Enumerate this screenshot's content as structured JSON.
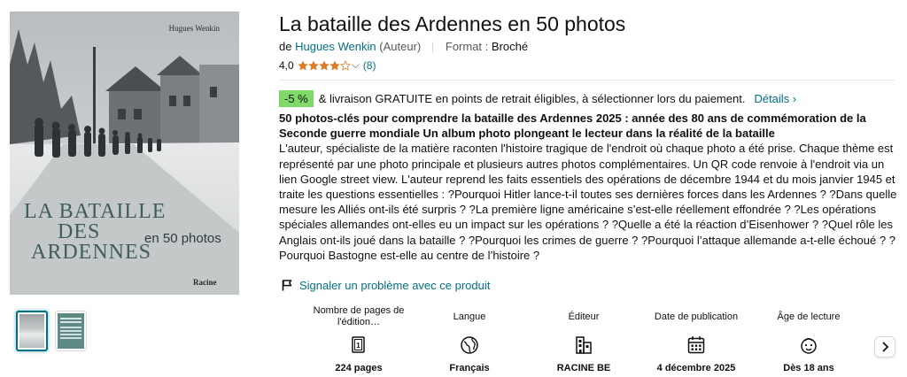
{
  "cover": {
    "author": "Hugues Wenkin",
    "title_line1": "La bataille",
    "title_line2": "des",
    "title_line3": "Ardennes",
    "subtitle": "en 50 photos",
    "publisher": "Racine"
  },
  "thumbnails": [
    "thumb-cover",
    "thumb-back"
  ],
  "product": {
    "title": "La bataille des Ardennes en 50 photos",
    "by_prefix": "de",
    "author": "Hugues Wenkin",
    "author_role": "(Auteur)",
    "separator": "|",
    "format_label": "Format :",
    "format_value": "Broché",
    "rating_value": "4,0",
    "rating_stars": 4,
    "rating_count": "(8)"
  },
  "deal": {
    "discount": "-5 %",
    "text": "& livraison GRATUITE en points de retrait éligibles, à sélectionner lors du paiement.",
    "details_link": "Détails ›"
  },
  "description": {
    "headline": "50 photos-clés pour comprendre la bataille des Ardennes 2025 : année des 80 ans de commémoration de la Seconde guerre mondiale Un album photo plongeant le lecteur dans la réalité de la bataille",
    "body": "L'auteur, spécialiste de la matière raconten l'histoire tragique de l'endroit où chaque photo a été prise. Chaque thème est représenté par une photo principale et plusieurs autres photos complémentaires. Un QR code renvoie à l'endroit via un lien Google street view. L'auteur reprend les faits essentiels des opérations de décembre 1944 et du mois janvier 1945 et traite les questions essentielles : ?Pourquoi Hitler lance-t-il toutes ses dernières forces dans les Ardennes ? ?Dans quelle mesure les Alliés ont-ils été surpris ? ?La première ligne américaine s’est-elle réellement effondrée ? ?Les opérations spéciales allemandes ont-elles eu un impact sur les opérations ? ?Quelle a été la réaction d’Eisenhower ? ?Quel rôle les Anglais ont-ils joué dans la bataille ? ?Pourquoi les crimes de guerre ? ?Pourquoi l’attaque allemande a-t-elle échoué ? ?Pourquoi Bastogne est-elle au centre de l’histoire ?"
  },
  "report_link": "Signaler un problème avec ce produit",
  "attributes": [
    {
      "label": "Nombre de pages de l'édition…",
      "icon": "pages-icon",
      "value": "224 pages"
    },
    {
      "label": "Langue",
      "icon": "globe-icon",
      "value": "Français"
    },
    {
      "label": "Éditeur",
      "icon": "building-icon",
      "value": "RACINE BE"
    },
    {
      "label": "Date de publication",
      "icon": "calendar-icon",
      "value": "4 décembre 2025"
    },
    {
      "label": "Âge de lecture",
      "icon": "child-face-icon",
      "value": "Dès 18 ans"
    }
  ],
  "colors": {
    "link": "#007185",
    "star": "#de7921",
    "badge": "#7fda69",
    "cover_title": "#3f5d5f"
  }
}
